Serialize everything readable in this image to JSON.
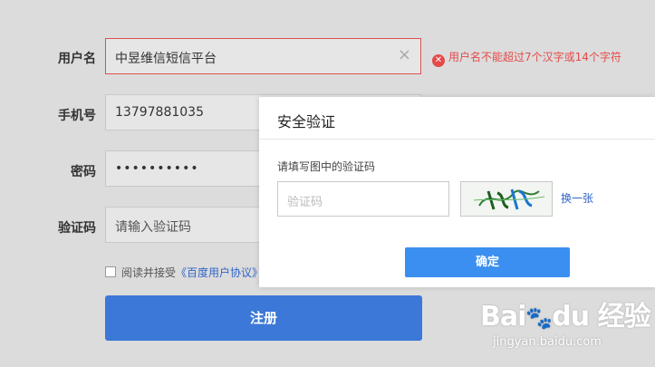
{
  "form": {
    "username_label": "用户名",
    "username_value": "中昱维信短信平台",
    "username_error": "用户名不能超过7个汉字或14个字符",
    "phone_label": "手机号",
    "phone_value": "13797881035",
    "password_label": "密码",
    "password_value": "••••••••••",
    "code_label": "验证码",
    "code_placeholder": "请输入验证码",
    "agree_prefix": "阅读并接受",
    "agree_link": "《百度用户协议》",
    "register_label": "注册"
  },
  "modal": {
    "title": "安全验证",
    "hint": "请填写图中的验证码",
    "input_placeholder": "验证码",
    "change_label": "换一张",
    "ok_label": "确定"
  },
  "watermark": {
    "logo_text": "Bai du 经验",
    "url": "jingyan.baidu.com"
  },
  "colors": {
    "primary": "#3b78d7",
    "error": "#e34a48",
    "link": "#2f64c7"
  },
  "icons": {
    "error": "error-circle-icon",
    "clear": "clear-x-icon"
  }
}
